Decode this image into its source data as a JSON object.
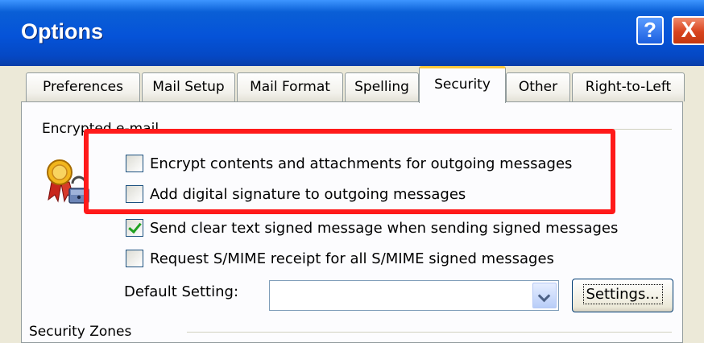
{
  "window": {
    "title": "Options",
    "help_glyph": "?",
    "close_glyph": "X"
  },
  "tabs": [
    {
      "label": "Preferences",
      "active": false
    },
    {
      "label": "Mail Setup",
      "active": false
    },
    {
      "label": "Mail Format",
      "active": false
    },
    {
      "label": "Spelling",
      "active": false
    },
    {
      "label": "Security",
      "active": true
    },
    {
      "label": "Other",
      "active": false
    },
    {
      "label": "Right-to-Left",
      "active": false
    }
  ],
  "encrypted_email": {
    "group_label": "Encrypted e-mail",
    "icon": "certificate-lock-icon",
    "options": [
      {
        "label": "Encrypt contents and attachments for outgoing messages",
        "checked": false
      },
      {
        "label": "Add digital signature to outgoing messages",
        "checked": false
      },
      {
        "label": "Send clear text signed message when sending signed messages",
        "checked": true
      },
      {
        "label": "Request S/MIME receipt for all S/MIME signed messages",
        "checked": false
      }
    ],
    "default_setting_label": "Default Setting:",
    "default_setting_value": "",
    "settings_button": "Settings..."
  },
  "security_zones_label": "Security Zones",
  "colors": {
    "highlight": "#ff1a1a",
    "title_bar": "#0553d8",
    "active_tab_accent": "#ffc83c",
    "checkmark": "#21a121"
  }
}
